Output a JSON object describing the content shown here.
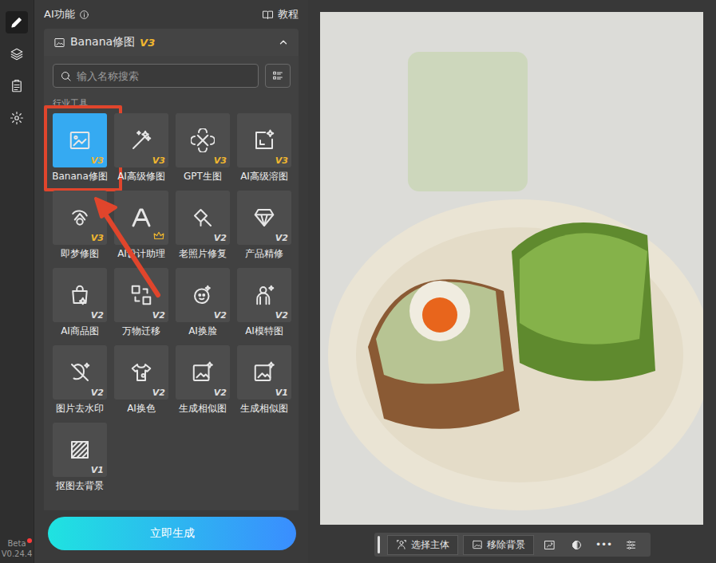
{
  "sidebar": {
    "items": [
      {
        "selected": true
      },
      {
        "selected": false
      },
      {
        "selected": false
      },
      {
        "selected": false
      }
    ],
    "beta": "Beta",
    "version": "V0.24.4"
  },
  "panel": {
    "title": "AI功能",
    "tutorial": "教程"
  },
  "section": {
    "title": "Banana修图",
    "badge": "V3",
    "expanded": true
  },
  "search": {
    "placeholder": "输入名称搜索"
  },
  "category": "行业工具",
  "tools": [
    {
      "label": "Banana修图",
      "badge": "V3",
      "kind": "version",
      "selected": true
    },
    {
      "label": "AI高级修图",
      "badge": "V3",
      "kind": "version",
      "selected": false
    },
    {
      "label": "GPT生图",
      "badge": "V3",
      "kind": "version",
      "selected": false
    },
    {
      "label": "AI高级溶图",
      "badge": "V3",
      "kind": "version",
      "selected": false
    },
    {
      "label": "即梦修图",
      "badge": "V3",
      "kind": "version",
      "selected": false
    },
    {
      "label": "AI设计助理",
      "badge": "",
      "kind": "crown",
      "selected": false
    },
    {
      "label": "老照片修复",
      "badge": "V2",
      "kind": "version",
      "selected": false
    },
    {
      "label": "产品精修",
      "badge": "V2",
      "kind": "version",
      "selected": false
    },
    {
      "label": "AI商品图",
      "badge": "V2",
      "kind": "version",
      "selected": false
    },
    {
      "label": "万物迁移",
      "badge": "V2",
      "kind": "version",
      "selected": false
    },
    {
      "label": "AI换脸",
      "badge": "V2",
      "kind": "version",
      "selected": false
    },
    {
      "label": "AI模特图",
      "badge": "V2",
      "kind": "version",
      "selected": false
    },
    {
      "label": "图片去水印",
      "badge": "V2",
      "kind": "version",
      "selected": false
    },
    {
      "label": "AI换色",
      "badge": "V2",
      "kind": "version",
      "selected": false
    },
    {
      "label": "生成相似图",
      "badge": "V2",
      "kind": "version",
      "selected": false
    },
    {
      "label": "生成相似图",
      "badge": "V1",
      "kind": "version",
      "selected": false
    },
    {
      "label": "抠图去背景",
      "badge": "V1",
      "kind": "version",
      "selected": false
    }
  ],
  "generate_button": "立即生成",
  "toolbar": {
    "buttons": [
      {
        "label": "选择主体"
      },
      {
        "label": "移除背景"
      }
    ],
    "more": "•••"
  }
}
